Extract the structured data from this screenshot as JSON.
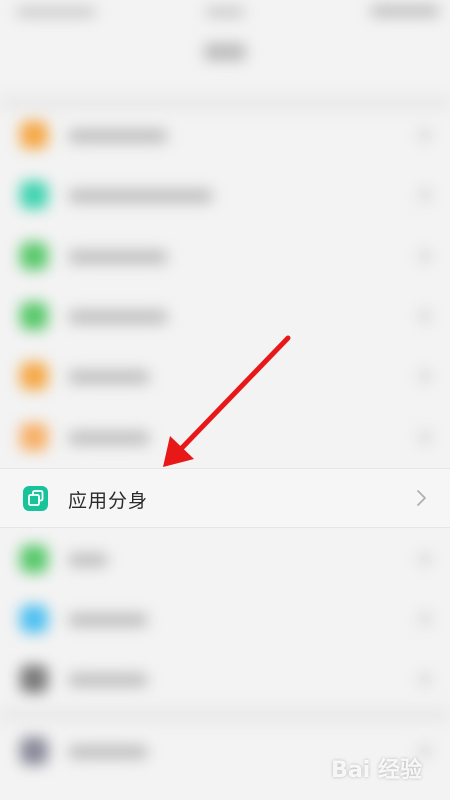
{
  "focused_item": {
    "label": "应用分身",
    "icon": "app-clone-icon",
    "icon_color": "#19c39a"
  },
  "blurred_rows": [
    {
      "icon_color": "#f5a847",
      "label_width": 100
    },
    {
      "icon_color": "#3fd3b0",
      "label_width": 145
    },
    {
      "icon_color": "#58c86a",
      "label_width": 100
    },
    {
      "icon_color": "#58c86a",
      "label_width": 100
    },
    {
      "icon_color": "#f5a847",
      "label_width": 82
    },
    {
      "icon_color": "#f7b068",
      "label_width": 82
    },
    {
      "icon_color": "#58c86a",
      "label_width": 40
    },
    {
      "icon_color": "#4fc0f0",
      "label_width": 80
    },
    {
      "icon_color": "#7a7a7a",
      "label_width": 80
    },
    {
      "icon_color": "#8a8a9a",
      "label_width": 80
    }
  ],
  "annotation": {
    "type": "arrow",
    "color": "#e81818"
  },
  "watermark": {
    "text": "Bai 经验"
  }
}
